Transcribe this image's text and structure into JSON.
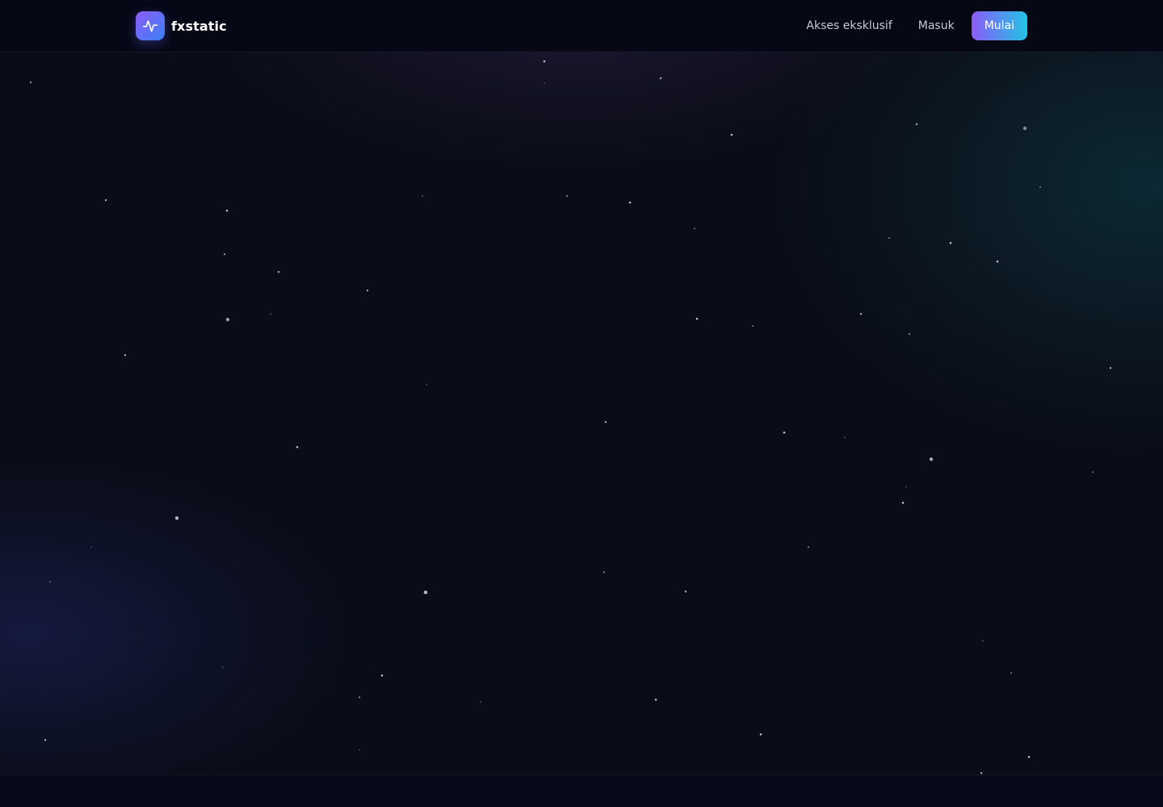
{
  "brand": {
    "name": "fxstatic",
    "icon": "pulse-icon",
    "gradient": [
      "#8b5cf6",
      "#3b82f6"
    ]
  },
  "nav": {
    "exclusive_access_label": "Akses eksklusif",
    "login_label": "Masuk",
    "start_label": "Mulai"
  },
  "colors": {
    "background": "#0a0d17",
    "header_background": "#060816",
    "accent_start": "#8b5cf6",
    "accent_end": "#22c3e6"
  }
}
